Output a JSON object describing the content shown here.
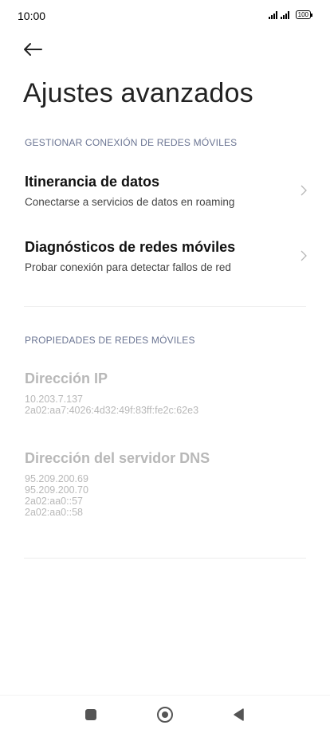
{
  "status_bar": {
    "time": "10:00",
    "battery": "100"
  },
  "page": {
    "title": "Ajustes avanzados"
  },
  "section_manage": {
    "header": "GESTIONAR CONEXIÓN DE REDES MÓVILES",
    "items": [
      {
        "title": "Itinerancia de datos",
        "subtitle": "Conectarse a servicios de datos en roaming"
      },
      {
        "title": "Diagnósticos de redes móviles",
        "subtitle": "Probar conexión para detectar fallos de red"
      }
    ]
  },
  "section_properties": {
    "header": "PROPIEDADES DE REDES MÓVILES",
    "ip": {
      "title": "Dirección IP",
      "values": [
        "10.203.7.137",
        "2a02:aa7:4026:4d32:49f:83ff:fe2c:62e3"
      ]
    },
    "dns": {
      "title": "Dirección del servidor DNS",
      "values": [
        "95.209.200.69",
        "95.209.200.70",
        "2a02:aa0::57",
        "2a02:aa0::58"
      ]
    }
  }
}
